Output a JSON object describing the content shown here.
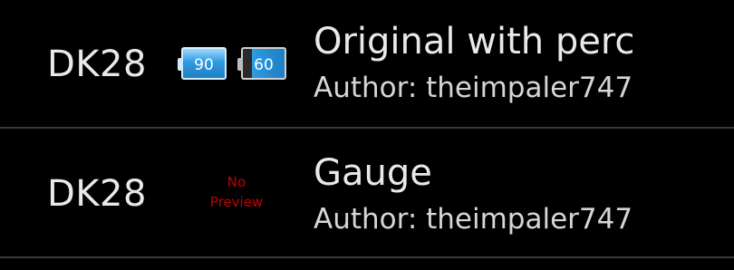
{
  "items": [
    {
      "device": "DK28",
      "title": "Original with perc",
      "author": "Author: theimpaler747",
      "preview": {
        "icon": "battery-icon",
        "levels": [
          "90",
          "60"
        ],
        "accent": "#2e9be0"
      }
    },
    {
      "device": "DK28",
      "title": "Gauge",
      "author": "Author: theimpaler747",
      "preview": {
        "icon": "no-preview-icon",
        "text_line1": "No",
        "text_line2": "Preview",
        "color": "#c40000"
      }
    }
  ]
}
